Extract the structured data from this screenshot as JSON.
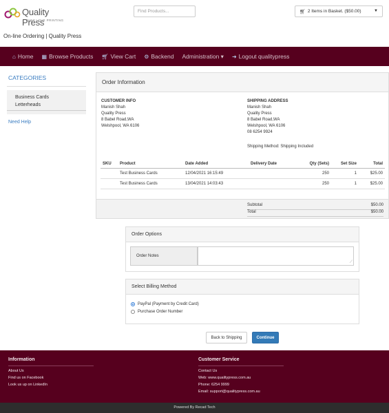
{
  "header": {
    "logo_text": "Quality Press",
    "logo_tagline": "JUST LOVE PRINTING",
    "search_placeholder": "Find Products...",
    "basket_label": "2 Items in Basket. ($50.00)",
    "site_title": "On-line Ordering | Quality Press",
    "colors": {
      "brand": "#56001e",
      "link": "#3b7dc1"
    }
  },
  "nav": {
    "items": [
      {
        "label": "Home",
        "icon": "home-icon"
      },
      {
        "label": "Browse Products",
        "icon": "grid-icon"
      },
      {
        "label": "View Cart",
        "icon": "cart-icon"
      },
      {
        "label": "Backend",
        "icon": "gears-icon"
      },
      {
        "label": "Administration ▾",
        "icon": ""
      },
      {
        "label": "Logout qualitypress",
        "icon": "sign-out-icon"
      }
    ]
  },
  "sidebar": {
    "title": "CATEGORIES",
    "items": [
      "Business Cards",
      "Letterheads"
    ],
    "help": "Need Help"
  },
  "order": {
    "title": "Order Information",
    "customer": {
      "heading": "CUSTOMER INFO",
      "lines": [
        "Manish Shah",
        "Quality Press",
        "8 Babel Road,WA",
        "Welshpool, WA 6106"
      ]
    },
    "shipping": {
      "heading": "SHIPPING ADDRESS",
      "lines": [
        "Manish Shah",
        "Quality Press",
        "8 Babel Road,WA",
        "Welshpool, WA 6106",
        "08 6254 9924"
      ],
      "method": "Shipping Method: Shipping Included"
    },
    "columns": [
      "SKU",
      "Product",
      "Date Added",
      "Delivery Date",
      "Qty (Sets)",
      "Set Size",
      "Total"
    ],
    "rows": [
      {
        "sku": "",
        "product": "Test Business Cards",
        "date": "12/04/2021 16:15:49",
        "delivery": "",
        "qty": "250",
        "set": "1",
        "total": "$25.00"
      },
      {
        "sku": "",
        "product": "Test Business Cards",
        "date": "13/04/2021 14:03:43",
        "delivery": "",
        "qty": "250",
        "set": "1",
        "total": "$25.00"
      }
    ],
    "subtotal_label": "Subtotal",
    "subtotal": "$50.00",
    "total_label": "Total",
    "total": "$50.00"
  },
  "options": {
    "title": "Order Options",
    "notes_label": "Order Notes",
    "notes_value": ""
  },
  "billing": {
    "title": "Select Billing Method",
    "options": [
      "PayPal (Payment by Credit Card)",
      "Purchase Order Number"
    ],
    "selected": 0
  },
  "buttons": {
    "back": "Back to Shipping",
    "continue": "Continue"
  },
  "footer": {
    "info_title": "Information",
    "info_links": [
      "About Us",
      "Find us on Facebook",
      "Look us up on LinkedIn"
    ],
    "service_title": "Customer Service",
    "service_links": [
      "Contact Us",
      "Web: www.qualitypress.com.au",
      "Phone: 6254 9999",
      "Email: support@qualitypress.com.au"
    ],
    "copyright": "Powered By Recad Tech"
  }
}
